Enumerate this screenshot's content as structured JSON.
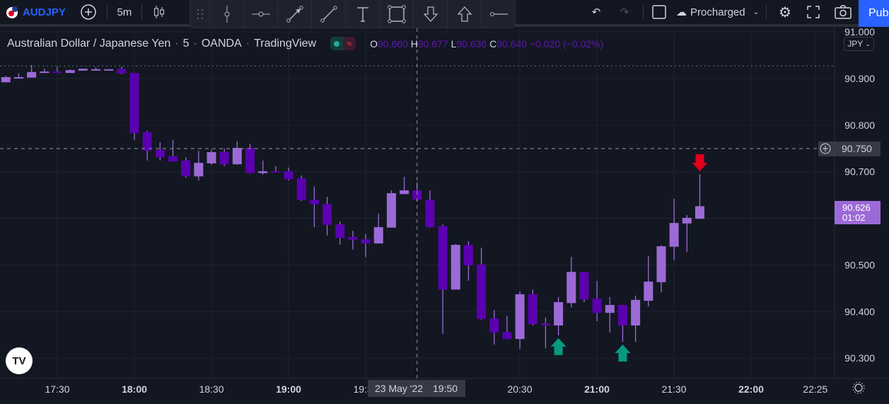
{
  "topbar": {
    "symbol": "AUDJPY",
    "interval": "5m",
    "layout_name": "Procharged",
    "publish_label": "Pub"
  },
  "legend": {
    "title": "Australian Dollar / Japanese Yen",
    "interval": "5",
    "exchange": "OANDA",
    "source": "TradingView",
    "o_label": "O",
    "o": "90.660",
    "h_label": "H",
    "h": "90.677",
    "l_label": "L",
    "l": "90.636",
    "c_label": "C",
    "c": "90.640",
    "change": "−0.020 (−0.02%)"
  },
  "price_axis": {
    "currency": "JPY",
    "ticks": [
      "91.000",
      "90.900",
      "90.800",
      "90.700",
      "90.500",
      "90.400",
      "90.300"
    ],
    "crosshair_price": "90.750",
    "last_price": "90.626",
    "countdown": "01:02"
  },
  "time_axis": {
    "ticks": [
      {
        "t": "17:30",
        "bold": false
      },
      {
        "t": "18:00",
        "bold": true
      },
      {
        "t": "18:30",
        "bold": false
      },
      {
        "t": "19:00",
        "bold": true
      },
      {
        "t": "19:30",
        "bold": false
      },
      {
        "t": "20:30",
        "bold": false
      },
      {
        "t": "21:00",
        "bold": true
      },
      {
        "t": "21:30",
        "bold": false
      },
      {
        "t": "22:00",
        "bold": true
      },
      {
        "t": "22:25",
        "bold": false
      }
    ],
    "crosshair_date": "23 May '22",
    "crosshair_time": "19:50"
  },
  "colors": {
    "bull": "#9c6ad6",
    "bear": "#5b00b0",
    "signal_up": "#089981",
    "signal_down": "#e0001b",
    "accent": "#2962ff",
    "background": "#131722"
  },
  "chart_data": {
    "type": "candlestick",
    "symbol": "AUDJPY",
    "interval": "5m",
    "start_time": "17:10",
    "ylim": [
      90.28,
      91.01
    ],
    "ohlc": [
      [
        90.892,
        90.906,
        90.892,
        90.903
      ],
      [
        90.902,
        90.911,
        90.901,
        90.903
      ],
      [
        90.902,
        90.929,
        90.902,
        90.914
      ],
      [
        90.912,
        90.921,
        90.912,
        90.915
      ],
      [
        90.915,
        90.926,
        90.913,
        90.913
      ],
      [
        90.912,
        90.92,
        90.912,
        90.918
      ],
      [
        90.917,
        90.921,
        90.917,
        90.921
      ],
      [
        90.919,
        90.924,
        90.918,
        90.92
      ],
      [
        90.919,
        90.92,
        90.919,
        90.92
      ],
      [
        90.921,
        90.926,
        90.909,
        90.911
      ],
      [
        90.912,
        90.912,
        90.768,
        90.783
      ],
      [
        90.785,
        90.788,
        90.724,
        90.745
      ],
      [
        90.747,
        90.763,
        90.724,
        90.731
      ],
      [
        90.733,
        90.768,
        90.722,
        90.722
      ],
      [
        90.724,
        90.731,
        90.687,
        90.69
      ],
      [
        90.69,
        90.745,
        90.681,
        90.719
      ],
      [
        90.718,
        90.748,
        90.715,
        90.742
      ],
      [
        90.742,
        90.75,
        90.712,
        90.716
      ],
      [
        90.716,
        90.765,
        90.715,
        90.751
      ],
      [
        90.751,
        90.76,
        90.697,
        90.697
      ],
      [
        90.697,
        90.724,
        90.694,
        90.701
      ],
      [
        90.701,
        90.712,
        90.699,
        90.7
      ],
      [
        90.701,
        90.709,
        90.681,
        90.684
      ],
      [
        90.686,
        90.692,
        90.637,
        90.639
      ],
      [
        90.64,
        90.668,
        90.581,
        90.63
      ],
      [
        90.631,
        90.646,
        90.563,
        90.586
      ],
      [
        90.587,
        90.593,
        90.543,
        90.558
      ],
      [
        90.56,
        90.573,
        90.533,
        90.554
      ],
      [
        90.555,
        90.566,
        90.517,
        90.546
      ],
      [
        90.546,
        90.61,
        90.546,
        90.581
      ],
      [
        90.58,
        90.66,
        90.58,
        90.654
      ],
      [
        90.652,
        90.689,
        90.652,
        90.66
      ],
      [
        90.66,
        90.677,
        90.636,
        90.64
      ],
      [
        90.64,
        90.66,
        90.58,
        90.581
      ],
      [
        90.583,
        90.587,
        90.352,
        90.447
      ],
      [
        90.447,
        90.545,
        90.447,
        90.543
      ],
      [
        90.543,
        90.551,
        90.466,
        90.499
      ],
      [
        90.501,
        90.537,
        90.382,
        90.384
      ],
      [
        90.385,
        90.403,
        90.329,
        90.355
      ],
      [
        90.356,
        90.391,
        90.341,
        90.341
      ],
      [
        90.341,
        90.443,
        90.32,
        90.437
      ],
      [
        90.437,
        90.447,
        90.37,
        90.373
      ],
      [
        90.374,
        90.387,
        90.321,
        90.37
      ],
      [
        90.37,
        90.431,
        90.349,
        90.42
      ],
      [
        90.418,
        90.517,
        90.409,
        90.485
      ],
      [
        90.485,
        90.485,
        90.42,
        90.426
      ],
      [
        90.428,
        90.466,
        90.379,
        90.397
      ],
      [
        90.397,
        90.431,
        90.355,
        90.414
      ],
      [
        90.414,
        90.414,
        90.335,
        90.37
      ],
      [
        90.37,
        90.434,
        90.335,
        90.425
      ],
      [
        90.423,
        90.519,
        90.411,
        90.464
      ],
      [
        90.463,
        90.542,
        90.441,
        90.54
      ],
      [
        90.539,
        90.642,
        90.51,
        90.59
      ],
      [
        90.589,
        90.607,
        90.528,
        90.601
      ],
      [
        90.599,
        90.695,
        90.599,
        90.626
      ]
    ],
    "signals": [
      {
        "index": 43,
        "type": "buy"
      },
      {
        "index": 48,
        "type": "buy"
      },
      {
        "index": 54,
        "type": "sell"
      }
    ],
    "high_line": 90.927,
    "grid": true
  }
}
